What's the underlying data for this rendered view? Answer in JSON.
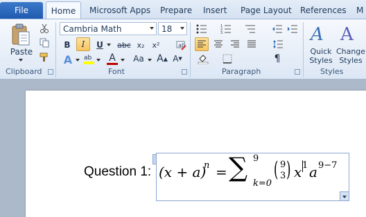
{
  "tabs": {
    "file": "File",
    "home": "Home",
    "microsoft_apps": "Microsoft Apps",
    "prepare": "Prepare",
    "insert": "Insert",
    "page_layout": "Page Layout",
    "references": "References",
    "overflow": "M"
  },
  "clipboard": {
    "paste_label": "Paste",
    "group_label": "Clipboard"
  },
  "font": {
    "family": "Cambria Math",
    "size": "18",
    "bold": "B",
    "italic": "I",
    "underline": "U",
    "strike": "abc",
    "subscript": "x₂",
    "superscript": "x²",
    "grow": "A",
    "shrink": "A",
    "clear": "A",
    "case": "Aa",
    "color_letter": "A",
    "group_label": "Font"
  },
  "paragraph": {
    "group_label": "Paragraph",
    "pilcrow": "¶"
  },
  "styles": {
    "quick_styles_line1": "Quick",
    "quick_styles_line2": "Styles",
    "change_styles_line1": "Change",
    "change_styles_line2": "Styles",
    "group_label": "Styles"
  },
  "document": {
    "question_label": "Question 1:",
    "equation": {
      "lhs": "(x + a)",
      "lhs_exp": "n",
      "equals": "=",
      "sigma": "∑",
      "upper": "9",
      "lower": "k=0",
      "binom_top": "9",
      "binom_bottom": "3",
      "x": "x",
      "x_exp": "1",
      "a": "a",
      "a_exp": "9−7"
    }
  },
  "colors": {
    "ribbon_bg": "#e8eff8",
    "file_tab": "#2a64b8",
    "active_highlight": "#f7c35f",
    "doc_bg": "#acb9ca",
    "font_color_bar": "#c00000",
    "highlight_bar": "#ffff00"
  }
}
